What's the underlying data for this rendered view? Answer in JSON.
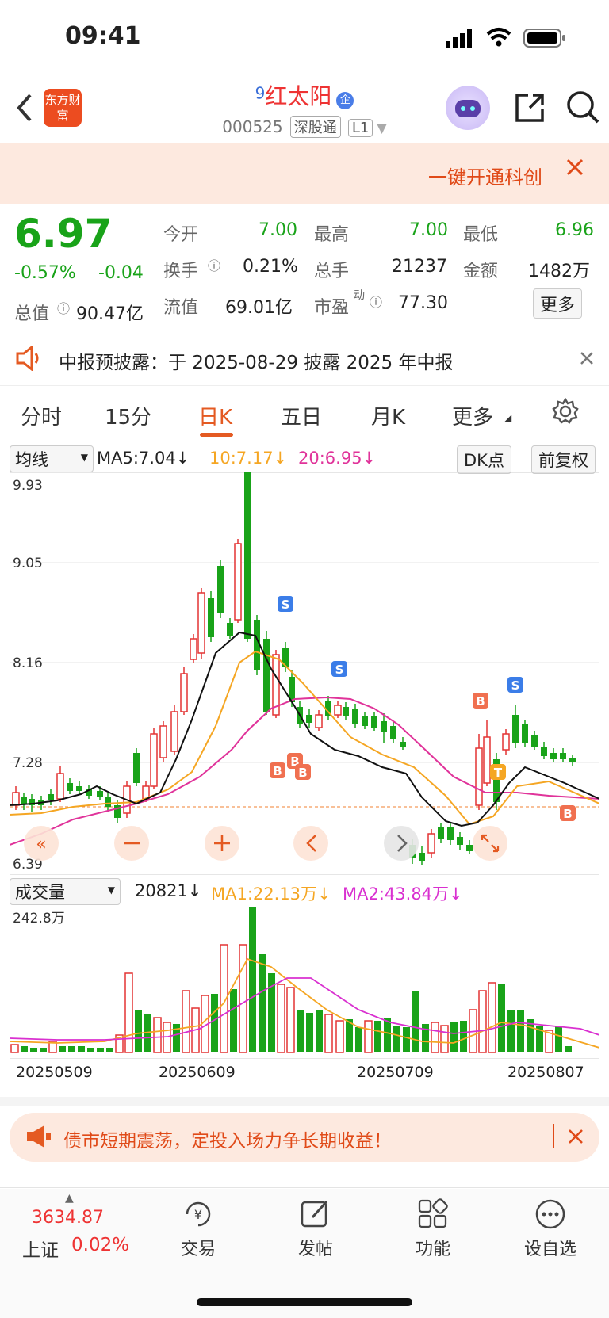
{
  "status": {
    "time": "09:41"
  },
  "header": {
    "logo_text": "东方财富",
    "badge_num": "9",
    "stock_name": "红太阳",
    "name_tag": "企",
    "code": "000525",
    "tag1": "深股通",
    "tag2": "L1"
  },
  "promo": {
    "text": "一键开通科创"
  },
  "quote": {
    "price": "6.97",
    "pct": "-0.57%",
    "chg": "-0.04",
    "open_label": "今开",
    "open": "7.00",
    "high_label": "最高",
    "high": "7.00",
    "low_label": "最低",
    "low": "6.96",
    "turnover_label": "换手",
    "turnover": "0.21%",
    "volume_label": "总手",
    "volume": "21237",
    "amount_label": "金额",
    "amount": "1482万",
    "mktcap_label": "总值",
    "mktcap": "90.47亿",
    "float_label": "流值",
    "float": "69.01亿",
    "pe_label": "市盈",
    "pe_sup": "动",
    "pe": "77.30",
    "more": "更多"
  },
  "notice": {
    "text": "中报预披露：于 2025-08-29 披露 2025 年中报"
  },
  "tabs": [
    "分时",
    "15分",
    "日K",
    "五日",
    "月K",
    "更多"
  ],
  "active_tab": "日K",
  "kline_legend": {
    "selector": "均线",
    "ma5": "MA5:7.04↓",
    "ma10": "10:7.17↓",
    "ma20": "20:6.95↓",
    "dk": "DK点",
    "adjust": "前复权"
  },
  "kline": {
    "y_ticks": [
      "9.93",
      "9.05",
      "8.16",
      "7.28",
      "6.39"
    ],
    "markers": [
      "S",
      "S",
      "S",
      "B",
      "B",
      "B",
      "B",
      "T",
      "B"
    ]
  },
  "volume_legend": {
    "selector": "成交量",
    "vol": "20821↓",
    "ma1": "MA1:22.13万↓",
    "ma2": "MA2:43.84万↓",
    "max": "242.8万"
  },
  "dates": [
    "20250509",
    "20250609",
    "20250709",
    "20250807"
  ],
  "ad": {
    "text": "债市短期震荡，定投入场力争长期收益！"
  },
  "bottom": {
    "index_value": "3634.87",
    "index_name": "上证",
    "index_pct": "0.02%",
    "nav": [
      "交易",
      "发帖",
      "功能",
      "设自选"
    ]
  },
  "colors": {
    "up": "#e33333",
    "down": "#19a319",
    "ma5": "#111111",
    "ma10": "#f5a623",
    "ma20": "#e0339a"
  }
}
